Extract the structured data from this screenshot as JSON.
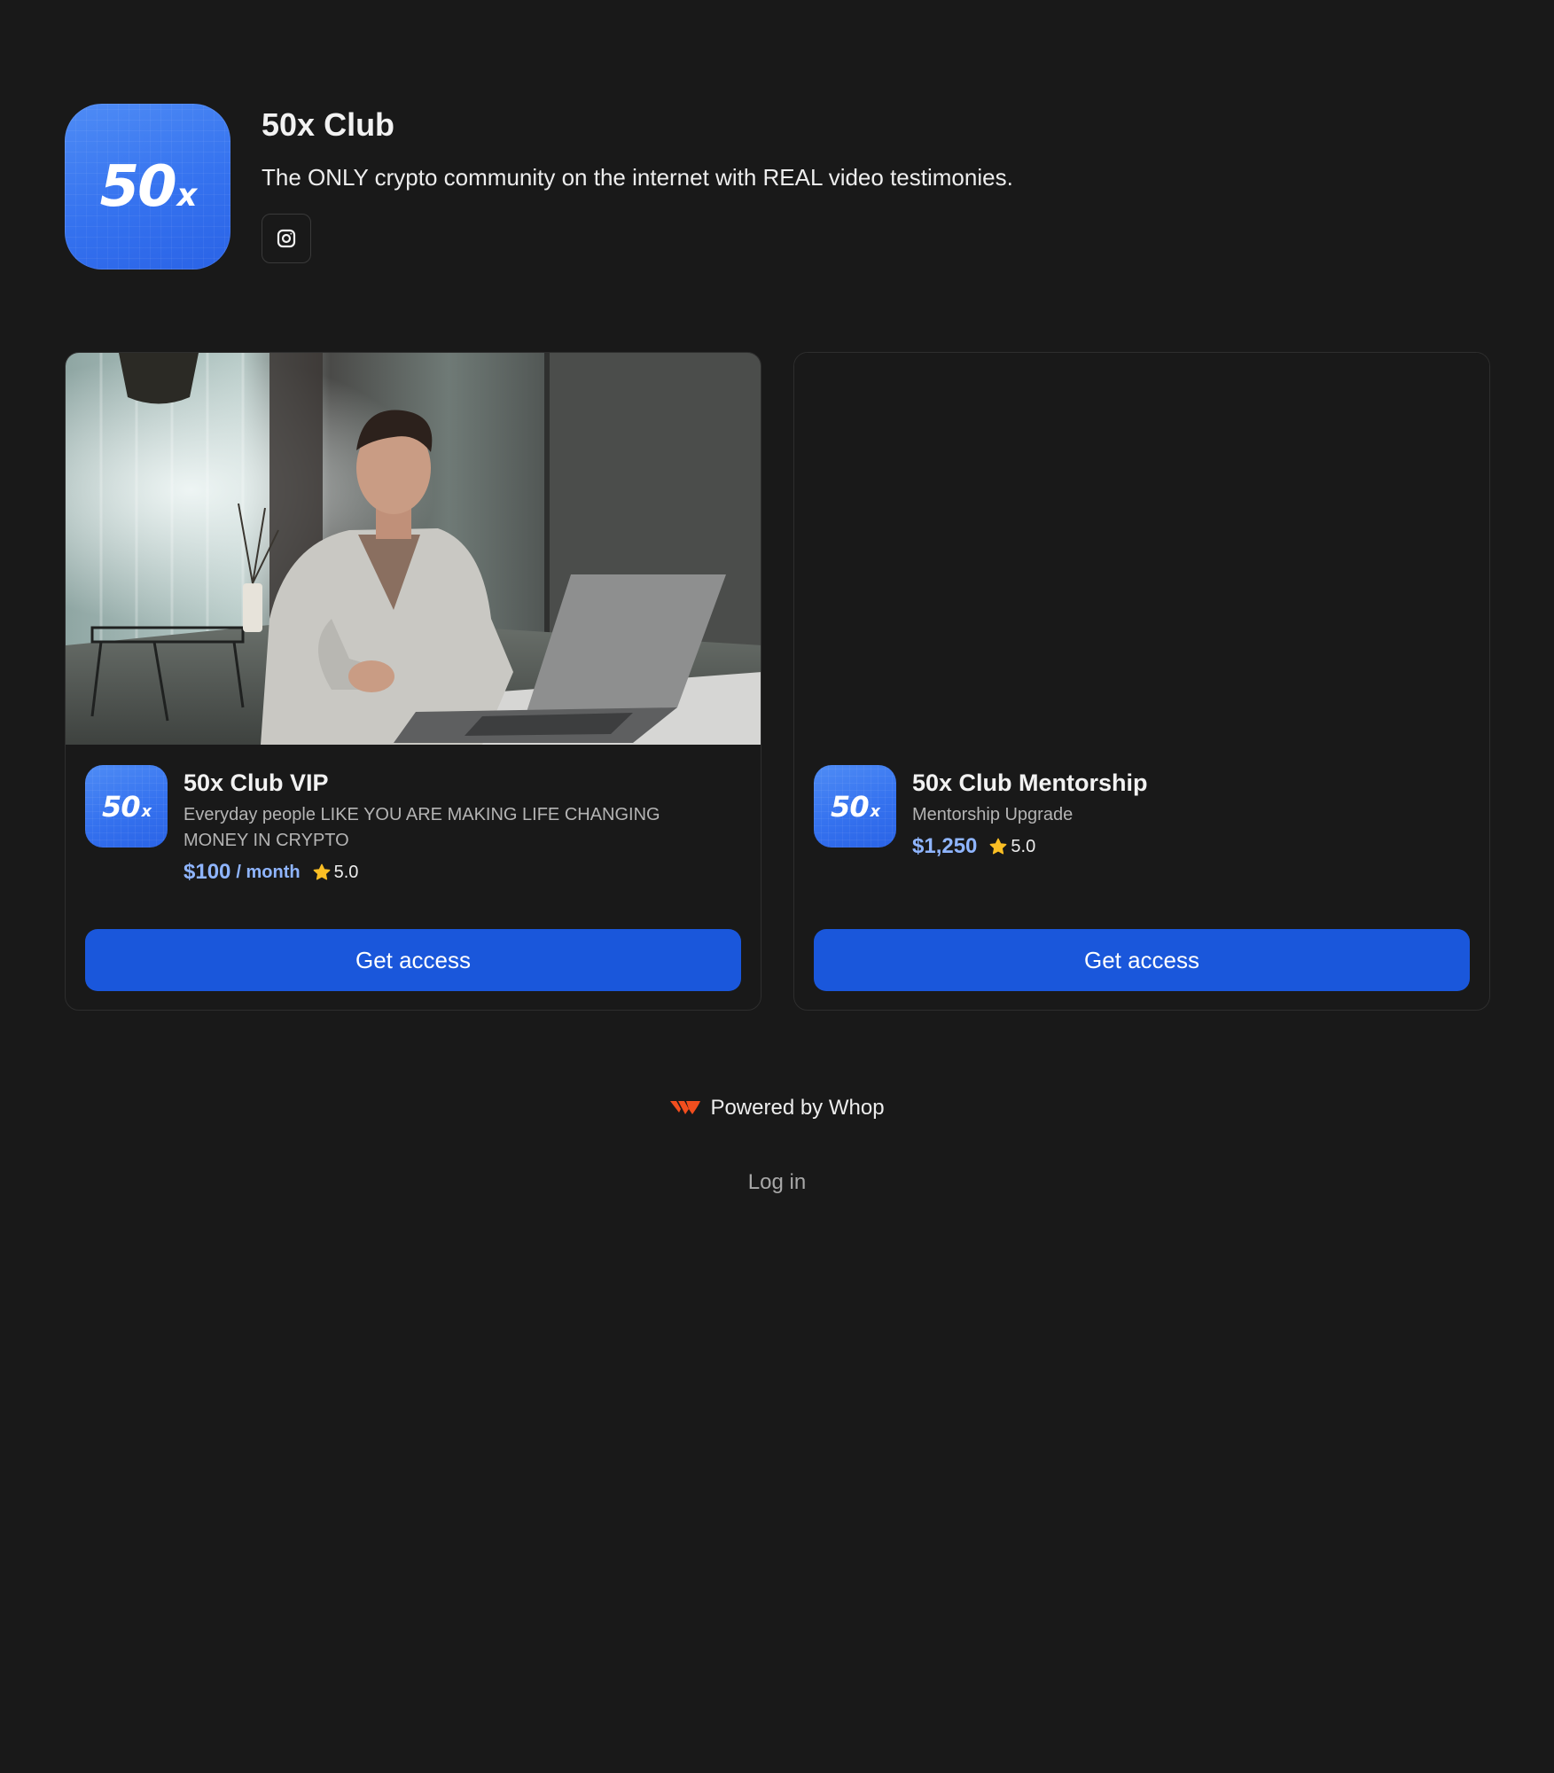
{
  "brand": {
    "logo_text": "50",
    "logo_suffix": "x",
    "title": "50x Club",
    "tagline": "The ONLY crypto community on the internet with REAL video testimonies.",
    "social_icon": "instagram-icon",
    "accent_color": "#3572ef"
  },
  "products": [
    {
      "title": "50x Club VIP",
      "description": "Everyday people LIKE YOU ARE MAKING LIFE CHANGING MONEY IN CRYPTO",
      "price": "$100",
      "period": "/ month",
      "rating": "5.0",
      "button_label": "Get access",
      "has_image": true
    },
    {
      "title": "50x Club Mentorship",
      "description": "Mentorship Upgrade",
      "price": "$1,250",
      "period": "",
      "rating": "5.0",
      "button_label": "Get access",
      "has_image": false
    }
  ],
  "footer": {
    "powered_by": "Powered by Whop",
    "login": "Log in"
  },
  "colors": {
    "background": "#191919",
    "button": "#1a57db",
    "price": "#8fb5ff",
    "star": "#fbbf24",
    "whop_logo": "#f24e1e"
  }
}
